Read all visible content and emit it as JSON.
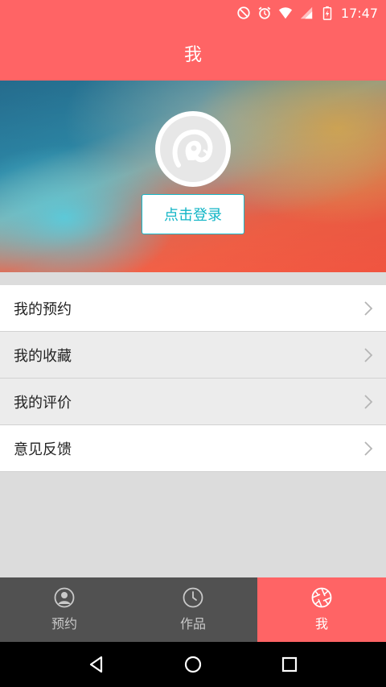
{
  "status_bar": {
    "time": "17:47",
    "icons": [
      "block-icon",
      "alarm-icon",
      "wifi-icon",
      "signal-icon",
      "battery-icon"
    ]
  },
  "header": {
    "title": "我"
  },
  "profile": {
    "login_label": "点击登录",
    "avatar_icon": "logo-placeholder-icon"
  },
  "menu": {
    "items": [
      {
        "label": "我的预约"
      },
      {
        "label": "我的收藏"
      },
      {
        "label": "我的评价"
      },
      {
        "label": "意见反馈"
      }
    ]
  },
  "tabs": [
    {
      "label": "预约",
      "icon": "user-circle-icon",
      "active": false
    },
    {
      "label": "作品",
      "icon": "clock-icon",
      "active": false
    },
    {
      "label": "我",
      "icon": "aperture-icon",
      "active": true
    }
  ],
  "navigation": {
    "buttons": [
      "back-icon",
      "home-icon",
      "recents-icon"
    ]
  },
  "colors": {
    "accent": "#ff6465",
    "login_text": "#12b5c6",
    "tab_bg": "#515151"
  }
}
